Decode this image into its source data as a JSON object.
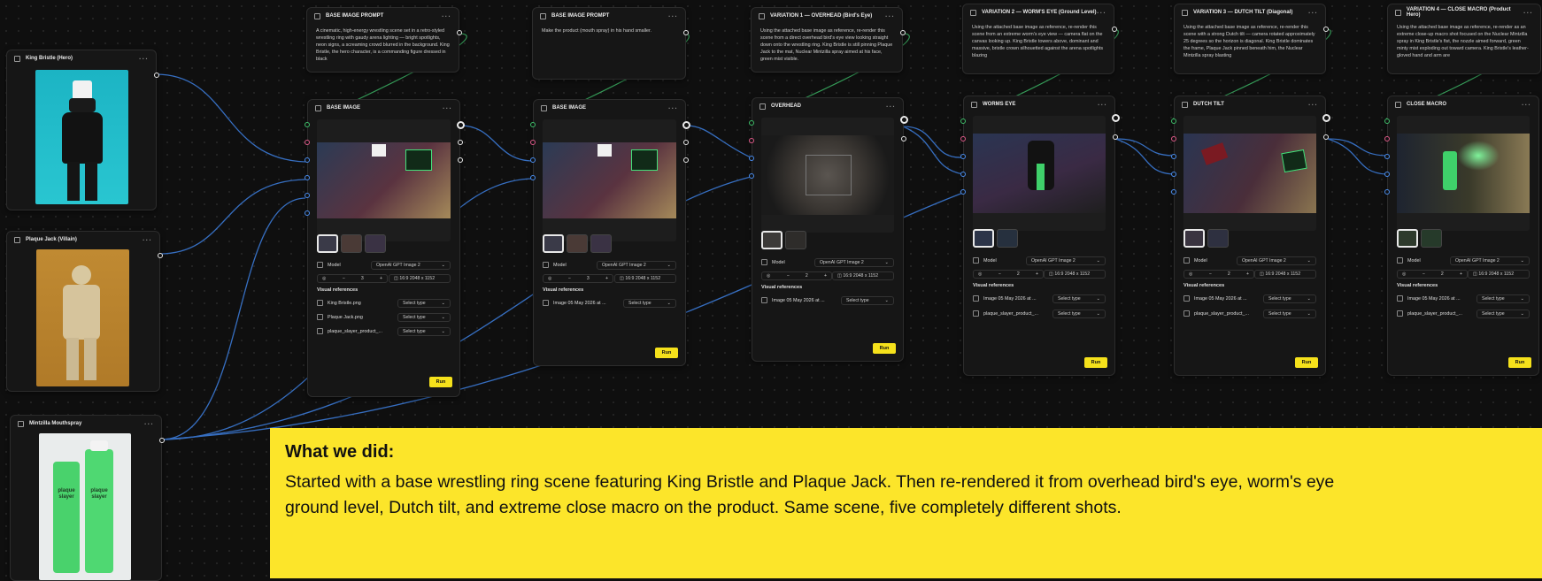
{
  "assets": [
    {
      "title": "King Bristle (Hero)"
    },
    {
      "title": "Plaque Jack (Villain)"
    },
    {
      "title": "Mintzilla Mouthspray"
    }
  ],
  "prompts": [
    {
      "title": "BASE IMAGE PROMPT",
      "text": "A cinematic, high-energy wrestling scene set in a retro-styled wrestling ring with gaudy arena lighting — bright spotlights, neon signs, a screaming crowd blurred in the background. King Bristle, the hero character, is a commanding figure dressed in black"
    },
    {
      "title": "BASE IMAGE PROMPT",
      "text": "Make the product (mouth spray) in his hand smaller."
    },
    {
      "title": "VARIATION 1 — OVERHEAD (Bird's Eye)",
      "text": "Using the attached base image as reference, re-render this scene from a direct overhead bird's eye view looking straight down onto the wrestling ring. King Bristle is still pinning Plaque Jack to the mat, Nuclear Mintzilla spray aimed at his face, green mist visible."
    },
    {
      "title": "VARIATION 2 — WORM'S EYE (Ground Level)",
      "text": "Using the attached base image as reference, re-render this scene from an extreme worm's eye view — camera flat on the canvas looking up. King Bristle towers above, dominant and massive, bristle crown silhouetted against the arena spotlights blazing"
    },
    {
      "title": "VARIATION 3 — DUTCH TILT (Diagonal)",
      "text": "Using the attached base image as reference, re-render this scene with a strong Dutch tilt — camera rotated approximately 25 degrees so the horizon is diagonal. King Bristle dominates the frame, Plaque Jack pinned beneath him, the Nuclear Mintzilla spray blasting"
    },
    {
      "title": "VARIATION 4 — CLOSE MACRO (Product Hero)",
      "text": "Using the attached base image as reference, re-render as an extreme close-up macro shot focused on the Nuclear Mintzilla spray in King Bristle's fist, the nozzle aimed forward, green minty mist exploding out toward camera. King Bristle's leather-gloved hand and arm are"
    }
  ],
  "generators": [
    {
      "title": "BASE IMAGE",
      "model_label": "Model",
      "model_value": "OpenAI GPT Image 2",
      "count": "3",
      "aspect": "16:9",
      "size": "2048 x 1152",
      "vr_label": "Visual references",
      "refs": [
        {
          "name": "King Bristle.png",
          "type": "Select type"
        },
        {
          "name": "Plaque Jack.png",
          "type": "Select type"
        },
        {
          "name": "plaque_slayer_product_...",
          "type": "Select type"
        }
      ],
      "run": "Run"
    },
    {
      "title": "BASE IMAGE",
      "model_label": "Model",
      "model_value": "OpenAI GPT Image 2",
      "count": "3",
      "aspect": "16:9",
      "size": "2048 x 1152",
      "vr_label": "Visual references",
      "refs": [
        {
          "name": "Image 05 May 2026 at ...",
          "type": "Select type"
        }
      ],
      "run": "Run"
    },
    {
      "title": "OVERHEAD",
      "model_label": "Model",
      "model_value": "OpenAI GPT Image 2",
      "count": "2",
      "aspect": "16:9",
      "size": "2048 x 1152",
      "vr_label": "Visual references",
      "refs": [
        {
          "name": "Image 05 May 2026 at ...",
          "type": "Select type"
        }
      ],
      "run": "Run"
    },
    {
      "title": "WORMS EYE",
      "model_label": "Model",
      "model_value": "OpenAI GPT Image 2",
      "count": "2",
      "aspect": "16:9",
      "size": "2048 x 1152",
      "vr_label": "Visual references",
      "refs": [
        {
          "name": "Image 05 May 2026 at ...",
          "type": "Select type"
        },
        {
          "name": "plaque_slayer_product_...",
          "type": "Select type"
        }
      ],
      "run": "Run"
    },
    {
      "title": "DUTCH TILT",
      "model_label": "Model",
      "model_value": "OpenAI GPT Image 2",
      "count": "2",
      "aspect": "16:9",
      "size": "2048 x 1152",
      "vr_label": "Visual references",
      "refs": [
        {
          "name": "Image 05 May 2026 at ...",
          "type": "Select type"
        },
        {
          "name": "plaque_slayer_product_...",
          "type": "Select type"
        }
      ],
      "run": "Run"
    },
    {
      "title": "CLOSE MACRO",
      "model_label": "Model",
      "model_value": "OpenAI GPT Image 2",
      "count": "2",
      "aspect": "16:9",
      "size": "2048 x 1152",
      "vr_label": "Visual references",
      "refs": [
        {
          "name": "Image 05 May 2026 at ...",
          "type": "Select type"
        },
        {
          "name": "plaque_slayer_product_...",
          "type": "Select type"
        }
      ],
      "run": "Run"
    }
  ],
  "product_label": {
    "line1": "plaque",
    "line2": "slayer"
  },
  "banner": {
    "heading": "What we did:",
    "body": "Started with a base wrestling ring scene featuring King Bristle and Plaque Jack. Then re-rendered it from overhead bird's eye, worm's eye ground level, Dutch tilt, and extreme close macro on the product. Same scene, five completely different shots."
  },
  "colors": {
    "run_button": "#f5e11b",
    "banner": "#fce52a",
    "wire": "#3d7fe0",
    "wire_green": "#3fbf6a"
  }
}
